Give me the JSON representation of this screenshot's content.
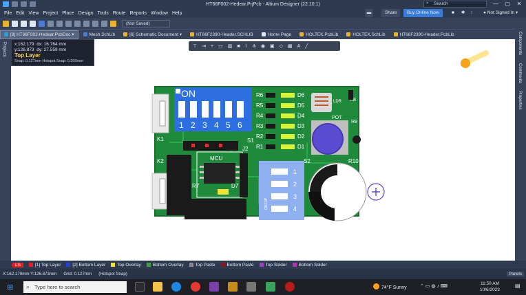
{
  "window": {
    "title": "HT66F002-Hedear.PrjPcb - Altium Designer (22.10.1)",
    "search_placeholder": "Search",
    "minimize": "—",
    "maximize": "▢",
    "close": "✕"
  },
  "menu": [
    "File",
    "Edit",
    "View",
    "Project",
    "Place",
    "Design",
    "Tools",
    "Route",
    "Reports",
    "Window",
    "Help"
  ],
  "menu_right": {
    "share": "Share",
    "buy": "Buy Online Now",
    "user": "Not Signed In"
  },
  "toolbar": {
    "save_state": "(Not Saved)"
  },
  "tabs": [
    {
      "label": "[9] HT66F002-Hedear.PcbDoc",
      "color": "#2d9cdb"
    },
    {
      "label": "Mesh.SchLib",
      "color": "#4b7bd6"
    },
    {
      "label": "[6] Schematic Document",
      "color": "#e9b230"
    },
    {
      "label": "HT66F2390-Header.SCHLIB",
      "color": "#4b7bd6"
    },
    {
      "label": "Home Page",
      "color": "#dfe6f2"
    },
    {
      "label": "HOLTEK.PcbLib",
      "color": "#e9b230"
    },
    {
      "label": "HOLTEK.SchLib",
      "color": "#4b7bd6"
    },
    {
      "label": "HT66F2390-Header.PcbLib",
      "color": "#e9b230"
    }
  ],
  "side_panels": {
    "left": "Projects",
    "right": [
      "Components",
      "Comments",
      "Properties"
    ]
  },
  "coords": {
    "x": "x:162.179",
    "dx": "dx: 16.764  mm",
    "y": "y:126.873",
    "dy": "dy: 27.559  mm",
    "layer": "Top Layer",
    "snap": "Snap: 0.127mm Hotspot Snap: 0.200mm"
  },
  "board": {
    "dip6_on": "ON",
    "dip6_nums": [
      "1",
      "2",
      "3",
      "4",
      "5",
      "6"
    ],
    "dip4_nums": [
      "1",
      "2",
      "3",
      "4"
    ],
    "dip4_side": "ON DIP",
    "resistors": [
      "R6",
      "R5",
      "R4",
      "R3",
      "R2",
      "R1"
    ],
    "leds": [
      "D6",
      "D5",
      "D4",
      "D3",
      "D2",
      "D1"
    ],
    "k1": "K1",
    "k2": "K2",
    "s1": "S1",
    "s2": "S2",
    "j2": "J2",
    "mcu": "MCU",
    "r7": "R7",
    "d7": "D7",
    "pot": "POT",
    "r8": "R8",
    "r9": "R9",
    "r10": "R10",
    "ldr": "LDR"
  },
  "layers": [
    {
      "label": "LS",
      "color": "#e62020"
    },
    {
      "label": "[1] Top Layer",
      "color": "#e62020"
    },
    {
      "label": "[2] Bottom Layer",
      "color": "#2540d6"
    },
    {
      "label": "Top Overlay",
      "color": "#f2e23a"
    },
    {
      "label": "Bottom Overlay",
      "color": "#3f9e3f"
    },
    {
      "label": "Top Paste",
      "color": "#8a8a8a"
    },
    {
      "label": "Bottom Paste",
      "color": "#8a1616"
    },
    {
      "label": "Top Solder",
      "color": "#9c40c7"
    },
    {
      "label": "Bottom Solder",
      "color": "#b430b4"
    }
  ],
  "layer_panel_btn": "Panels",
  "status": {
    "pos": "X:162.179mm Y:126.873mm",
    "grid": "Grid: 0.127mm",
    "hotspot": "(Hotspot Snap)"
  },
  "taskbar": {
    "search_placeholder": "Type here to search",
    "weather": "74°F  Sunny",
    "time": "11:50 AM",
    "date": "10/6/2023"
  }
}
